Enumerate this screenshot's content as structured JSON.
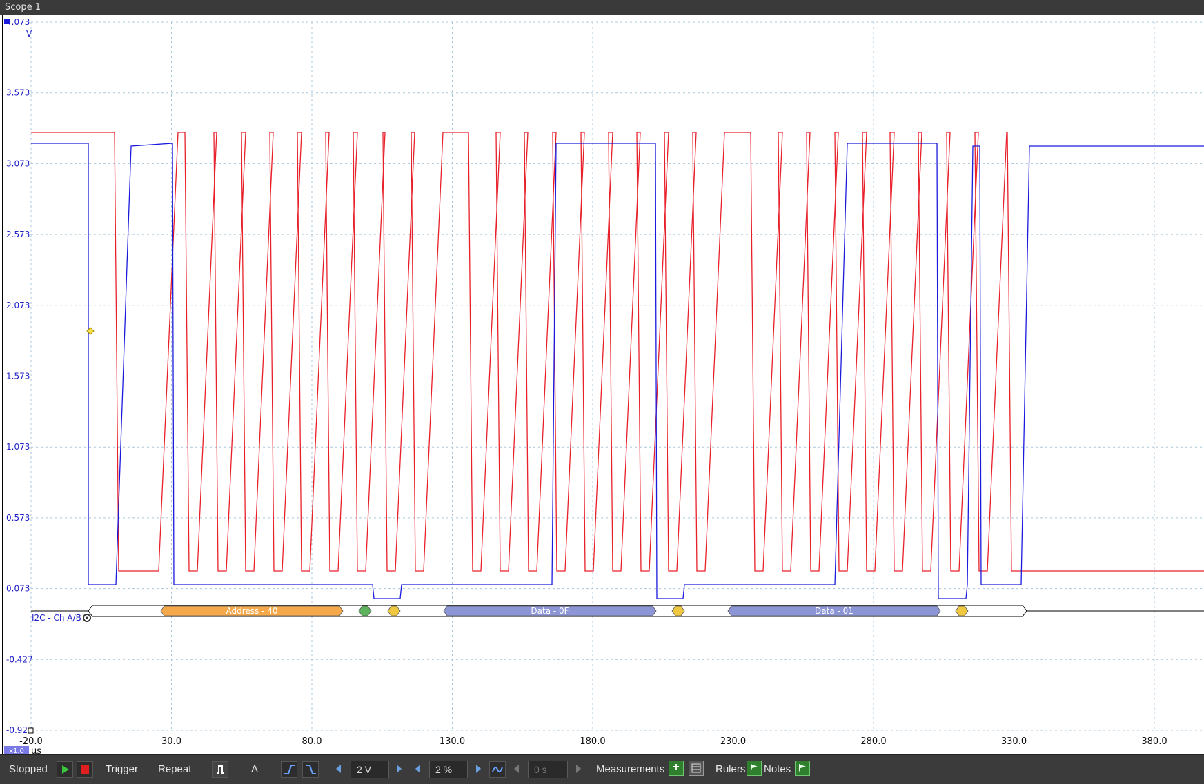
{
  "window": {
    "title": "Scope 1"
  },
  "axis": {
    "y_unit": "V",
    "y_ticks": [
      "4.073",
      "3.573",
      "3.073",
      "2.573",
      "2.073",
      "1.573",
      "1.073",
      "0.573",
      "0.073",
      "-0.427",
      "-0.927"
    ],
    "x_unit": "µs",
    "x_ticks": [
      "-20.0",
      "30.0",
      "80.0",
      "130.0",
      "180.0",
      "230.0",
      "280.0",
      "330.0",
      "380.0"
    ],
    "zoom_badge": "x1.0"
  },
  "decoder": {
    "label": "I2C - Ch A/B",
    "packets": [
      {
        "type": "data",
        "label": "Address - 40",
        "color": "#f5a94a"
      },
      {
        "type": "ack",
        "label": "",
        "color": "#5cb35c"
      },
      {
        "type": "ack",
        "label": "",
        "color": "#f0c840"
      },
      {
        "type": "data",
        "label": "Data - 0F",
        "color": "#8c96d6"
      },
      {
        "type": "ack",
        "label": "",
        "color": "#f0c840"
      },
      {
        "type": "data",
        "label": "Data - 01",
        "color": "#8c96d6"
      },
      {
        "type": "ack",
        "label": "",
        "color": "#f0c840"
      }
    ]
  },
  "colors": {
    "channel_a": "#e8202a",
    "channel_b": "#1a1adc",
    "grid": "#a8c8dc"
  },
  "toolbar": {
    "status": "Stopped",
    "trigger_label": "Trigger",
    "repeat_label": "Repeat",
    "trigger_channel": "A",
    "threshold_value": "2 V",
    "pretrigger_value": "2 %",
    "delay_value": "0 s",
    "measurements_label": "Measurements",
    "rulers_label": "Rulers",
    "notes_label": "Notes"
  }
}
